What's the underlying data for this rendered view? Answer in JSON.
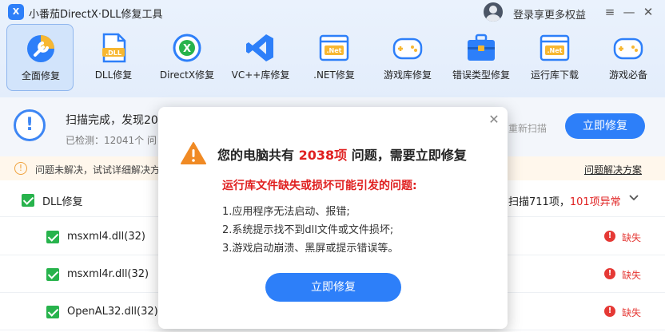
{
  "app": {
    "title": "小番茄DirectX·DLL修复工具",
    "logo_text": "X",
    "login_text": "登录享更多权益",
    "window_buttons": {
      "menu": "≡",
      "minimize": "—",
      "close": "✕"
    }
  },
  "toolbar": {
    "items": [
      {
        "label": "全面修复",
        "icon": "wrench-repair-icon"
      },
      {
        "label": "DLL修复",
        "icon": "dll-file-icon",
        "badge": ".DLL"
      },
      {
        "label": "DirectX修复",
        "icon": "directx-icon",
        "badge": "X"
      },
      {
        "label": "VC++库修复",
        "icon": "visual-studio-icon"
      },
      {
        "label": ".NET修复",
        "icon": "dotnet-window-icon",
        "badge": ".Net"
      },
      {
        "label": "游戏库修复",
        "icon": "gamepad-icon"
      },
      {
        "label": "错误类型修复",
        "icon": "toolbox-icon"
      },
      {
        "label": "运行库下载",
        "icon": "dotnet-download-icon",
        "badge": ".Net"
      },
      {
        "label": "游戏必备",
        "icon": "gamepad-essential-icon"
      }
    ]
  },
  "summary": {
    "title": "扫描完成，发现20",
    "subtitle": "已检测：12041个 问",
    "rescan": "重新扫描",
    "fix_button": "立即修复"
  },
  "notice": {
    "text": "问题未解决，试试详细解决方",
    "link": "问题解决方案"
  },
  "list": {
    "group": {
      "name": "DLL修复",
      "scanned": "扫描711项，",
      "abnormal": "101项异常"
    },
    "rows": [
      {
        "name": "msxml4.dll(32)",
        "status": "缺失"
      },
      {
        "name": "msxml4r.dll(32)",
        "status": "缺失"
      },
      {
        "name": "OpenAL32.dll(32)",
        "status": "缺失"
      }
    ]
  },
  "dialog": {
    "title_prefix": "您的电脑共有 ",
    "title_count": "2038项",
    "title_suffix": " 问题，需要立即修复",
    "subtitle": "运行库文件缺失或损坏可能引发的问题:",
    "items": [
      "1.应用程序无法启动、报错;",
      "2.系统提示找不到dll文件或文件损坏;",
      "3.游戏启动崩溃、黑屏或提示错误等。"
    ],
    "button": "立即修复",
    "close": "✕"
  },
  "colors": {
    "accent": "#2d7ff9",
    "danger": "#e02020",
    "success": "#27b34c",
    "warning": "#f0a23c"
  }
}
